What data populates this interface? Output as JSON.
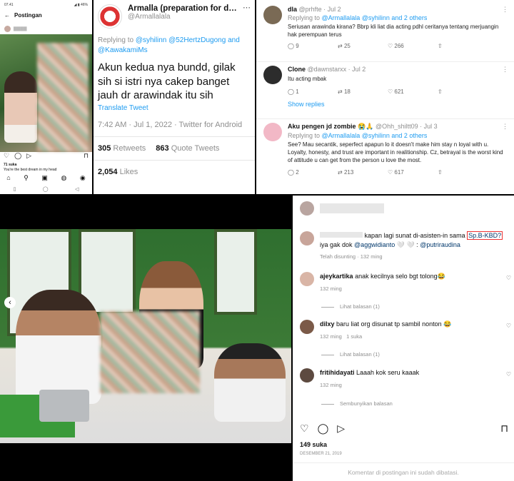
{
  "instagram_post": {
    "status_time": "07.41",
    "status_icons": "◢ ▮ 46%",
    "back_icon": "←",
    "title": "Postingan",
    "username_blurred": "▇▇▇▇",
    "likes": "71 suka",
    "caption": "You're the best dream in my head",
    "action_icons": [
      "♡",
      "◯",
      "▷"
    ],
    "bookmark_icon": "⊓",
    "nav_icons": [
      "⌂",
      "⚲",
      "▣",
      "◍",
      "◉"
    ],
    "system_icons": [
      "▯",
      "◯",
      "◁"
    ]
  },
  "tweet_main": {
    "name": "Armalla (preparation for d…",
    "handle": "@Armallalala",
    "more_icon": "⋯",
    "replying_label": "Replying to",
    "replying_to": "@syhilinn @52HertzDugong and @KawakamiMs",
    "text": "Akun kedua nya bundd, gilak sih si istri nya cakep banget jauh dr arawindak itu sih",
    "translate": "Translate Tweet",
    "meta": "7:42 AM · Jul 1, 2022 · Twitter for Android",
    "retweets_num": "305",
    "retweets_label": "Retweets",
    "quotes_num": "863",
    "quotes_label": "Quote Tweets",
    "likes_num": "2,054",
    "likes_label": "Likes"
  },
  "tweet_replies": [
    {
      "name": "dla",
      "handle": "@prhfte · Jul 2",
      "replying": "Replying to",
      "replying_to": "@Armallalala @syhilinn and 2 others",
      "text": "Seriusan arawinda kirana? Bbrp kli liat dia acting pdhl ceritanya tentang merjuangin hak perempuan terus",
      "replies": "9",
      "rts": "25",
      "likes": "266"
    },
    {
      "name": "Clone",
      "handle": "@dawnstarxx · Jul 2",
      "replying": "",
      "replying_to": "",
      "text": "Itu acting mbak",
      "replies": "1",
      "rts": "18",
      "likes": "621"
    },
    {
      "name": "Aku pengen jd zombie 😭🙏",
      "handle": "@Ohh_shiltt09 · Jul 3",
      "replying": "Replying to",
      "replying_to": "@Armallalala @syhilinn and 2 others",
      "text": "See? Mau secantik, seperfect apapun lo it doesn't make him stay n loyal with u. Loyalty, honesty, and trust are important in realitionship. Cz, betrayal is the worst kind of attitude u can get from the person u love the most.",
      "replies": "2",
      "rts": "213",
      "likes": "617"
    }
  ],
  "show_replies": "Show replies",
  "tw_icons": {
    "reply": "◯",
    "retweet": "⇄",
    "like": "♡",
    "share": "⇧",
    "more": "⋮"
  },
  "photo_post": {
    "prev_icon": "‹"
  },
  "ig_comments": {
    "top_comment_text": "kapan lagi sunat di-asisten-in sama",
    "top_comment_tag": "Sp.B-KBD?",
    "top_comment_text2": "iya gak dok",
    "top_comment_mention1": "@aggwidianto",
    "top_comment_mention2": "@putriraudina",
    "top_comment_symbols": "🤍 🤍 :",
    "edited": "Telah disunting · 132 ming",
    "comments": [
      {
        "user": "ajeykartika",
        "text": "anak kecilnya selo bgt tolong😂",
        "meta": "132 ming",
        "view": "Lihat balasan (1)"
      },
      {
        "user": "dilxy",
        "text": "baru liat org disunat tp sambil nonton 😂",
        "meta": "132 ming",
        "likes": "1 suka",
        "view": "Lihat balasan (1)"
      },
      {
        "user": "fritihidayati",
        "text": "Laaah kok seru kaaak",
        "meta": "132 ming",
        "view": "Sembunyikan balasan"
      }
    ],
    "heart_icon": "♡",
    "action_icons": [
      "♡",
      "◯",
      "▷"
    ],
    "bookmark_icon": "⊓",
    "likes": "149 suka",
    "date": "DESEMBER 21, 2019",
    "disabled": "Komentar di postingan ini sudah dibatasi."
  }
}
